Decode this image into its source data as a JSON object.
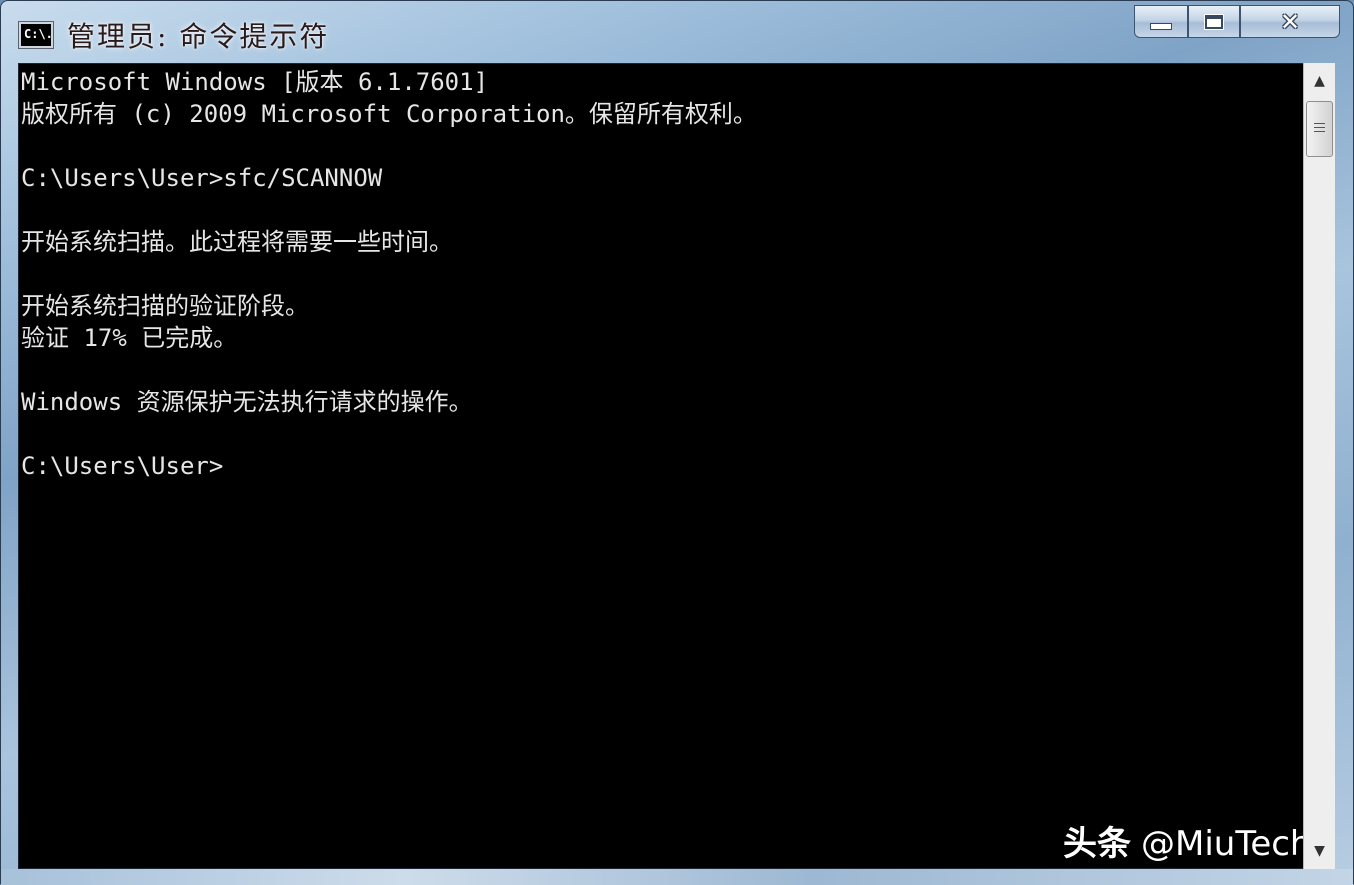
{
  "window": {
    "title": "管理员: 命令提示符",
    "icon_label": "C:\\.",
    "controls": {
      "minimize": "minimize-icon",
      "maximize": "maximize-icon",
      "close": "close-icon"
    }
  },
  "console": {
    "background": "#000000",
    "foreground": "#e6e6e6",
    "lines": [
      "Microsoft Windows [版本 6.1.7601]",
      "版权所有 (c) 2009 Microsoft Corporation。保留所有权利。",
      "",
      "C:\\Users\\User>sfc/SCANNOW",
      "",
      "开始系统扫描。此过程将需要一些时间。",
      "",
      "开始系统扫描的验证阶段。",
      "验证 17% 已完成。",
      "",
      "Windows 资源保护无法执行请求的操作。",
      "",
      "C:\\Users\\User>"
    ]
  },
  "scrollbar": {
    "up_arrow": "▲",
    "down_arrow": "▼"
  },
  "watermark": {
    "prefix": "头条",
    "handle": "@MiuTech"
  }
}
